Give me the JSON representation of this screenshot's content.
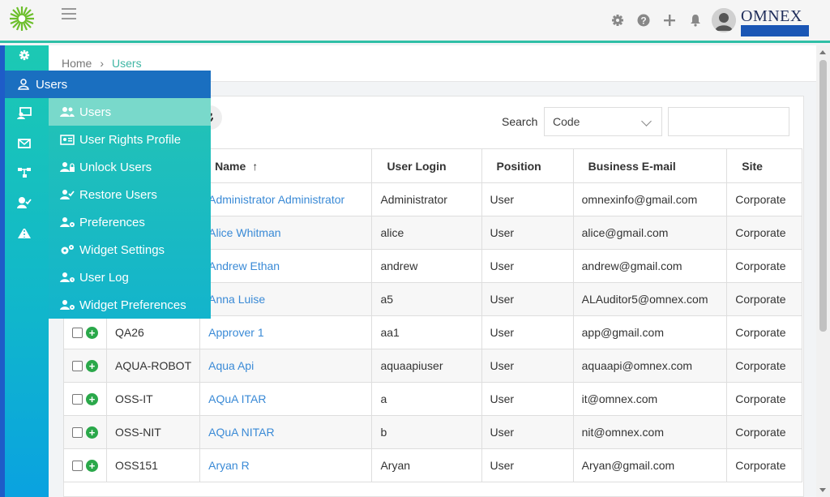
{
  "topbar": {
    "brand": "OMNEX",
    "icons": [
      "gear-icon",
      "help-icon",
      "plus-icon",
      "bell-icon",
      "user-avatar-icon"
    ]
  },
  "breadcrumb": {
    "home": "Home",
    "current": "Users"
  },
  "flyout": {
    "title": "Users",
    "items": [
      {
        "label": "Users",
        "icon": "users-icon",
        "active": true
      },
      {
        "label": "User Rights Profile",
        "icon": "id-card-icon"
      },
      {
        "label": "Unlock Users",
        "icon": "user-lock-icon"
      },
      {
        "label": "Restore Users",
        "icon": "user-check-icon"
      },
      {
        "label": "Preferences",
        "icon": "user-cog-icon"
      },
      {
        "label": "Widget Settings",
        "icon": "cogs-icon"
      },
      {
        "label": "User Log",
        "icon": "user-clock-icon"
      },
      {
        "label": "Widget Preferences",
        "icon": "user-cog-icon"
      }
    ]
  },
  "search": {
    "label": "Search",
    "field_value": "Code",
    "input_value": ""
  },
  "table": {
    "headers": {
      "name": "Name",
      "login": "User Login",
      "position": "Position",
      "email": "Business E-mail",
      "site": "Site"
    },
    "rows": [
      {
        "code": "",
        "name": "Administrator Administrator",
        "login": "Administrator",
        "position": "User",
        "email": "omnexinfo@gmail.com",
        "site": "Corporate"
      },
      {
        "code": "",
        "name": "Alice Whitman",
        "login": "alice",
        "position": "User",
        "email": "alice@gmail.com",
        "site": "Corporate"
      },
      {
        "code": "",
        "name": "Andrew Ethan",
        "login": "andrew",
        "position": "User",
        "email": "andrew@gmail.com",
        "site": "Corporate"
      },
      {
        "code": "",
        "name": "Anna Luise",
        "login": "a5",
        "position": "User",
        "email": "ALAuditor5@omnex.com",
        "site": "Corporate"
      },
      {
        "code": "QA26",
        "name": "Approver 1",
        "login": "aa1",
        "position": "User",
        "email": "app@gmail.com",
        "site": "Corporate"
      },
      {
        "code": "AQUA-ROBOT",
        "name": "Aqua Api",
        "login": "aquaapiuser",
        "position": "User",
        "email": "aquaapi@omnex.com",
        "site": "Corporate"
      },
      {
        "code": "OSS-IT",
        "name": "AQuA ITAR",
        "login": "a",
        "position": "User",
        "email": "it@omnex.com",
        "site": "Corporate"
      },
      {
        "code": "OSS-NIT",
        "name": "AQuA NITAR",
        "login": "b",
        "position": "User",
        "email": "nit@omnex.com",
        "site": "Corporate"
      },
      {
        "code": "OSS151",
        "name": "Aryan R",
        "login": "Aryan",
        "position": "User",
        "email": "Aryan@gmail.com",
        "site": "Corporate"
      }
    ]
  },
  "colors": {
    "accent": "#2fbfa6",
    "flyout_header": "#1a6fc0",
    "link": "#3a8ad6",
    "add_button": "#2aa84a"
  }
}
